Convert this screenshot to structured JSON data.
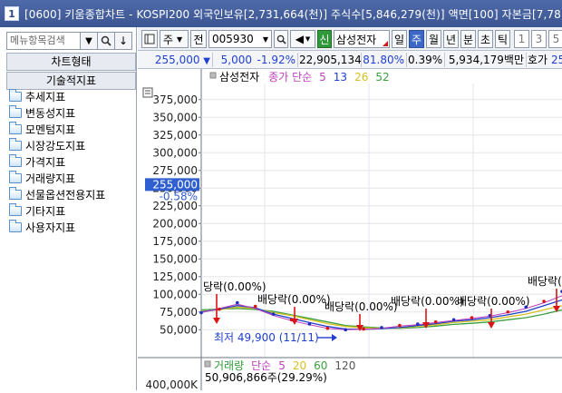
{
  "window": {
    "num": "1",
    "title": "[0600] 키움종합차트 - KOSPI200 외국인보유[2,731,664(천)] 주식수[5,846,279(천)] 액면[100] 자본금[7,78"
  },
  "left": {
    "search_placeholder": "메뉴항목검색",
    "chart_state_label": "차트형태",
    "tech_indicators_label": "기술적지표",
    "tree": [
      "추세지표",
      "변동성지표",
      "모멘텀지표",
      "시장강도지표",
      "가격지표",
      "거래량지표",
      "선물옵션전용지표",
      "기타지표",
      "사용자지표"
    ]
  },
  "toolbar": {
    "period": "주",
    "prev": "전",
    "code": "005930",
    "new_label": "신",
    "stock_name": "삼성전자",
    "tabs": [
      "일",
      "주",
      "월",
      "년",
      "분",
      "초",
      "틱"
    ],
    "active_tab": "주",
    "nums": [
      "1",
      "3",
      "5"
    ]
  },
  "quote": {
    "price": "255,000",
    "change": "5,000",
    "change_pct": "-1.92%",
    "volume": "22,905,134",
    "ratio": "81.80%",
    "turnover": "0.39%",
    "amount": "5,934,179백만",
    "hoga_label": "호가",
    "hoga_val": "25"
  },
  "chart_data": {
    "type": "line",
    "price_legend": {
      "name": "삼성전자",
      "ma_label": "종가 단순",
      "periods": [
        "5",
        "13",
        "26",
        "52"
      ]
    },
    "ylim": [
      37500,
      387500
    ],
    "yticks": [
      "375,000",
      "350,000",
      "325,000",
      "300,000",
      "275,000",
      "250,000",
      "225,000",
      "200,000",
      "175,000",
      "150,000",
      "125,000",
      "100,000",
      "75,000",
      "50,000"
    ],
    "current": {
      "value": 255000,
      "label": "255,000",
      "pct": "-0.58%"
    },
    "low_label": "최저 49,900 (11/11)",
    "dividends": [
      "당락(0.00%)",
      "배당락(0.00%)",
      "배당락(0.00%)",
      "배당락(0.00%)",
      "배당락(0.00%)",
      "배당락(0.00%)"
    ],
    "colors": {
      "price": "#2030c0",
      "ma5": "#c040c0",
      "ma13": "#2040c8",
      "ma26": "#d7c020",
      "ma52": "#3aa040",
      "marker": "#d81414"
    },
    "volume_legend": {
      "name": "거래량",
      "ma_label": "단순",
      "periods": [
        "5",
        "20",
        "60",
        "120"
      ],
      "value_text": "50,906,866주(29.29%)",
      "first_tick": "400,000K"
    }
  }
}
